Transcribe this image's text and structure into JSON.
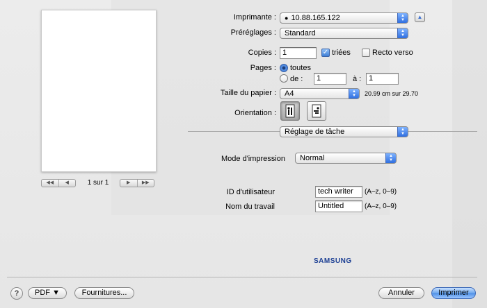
{
  "printer": {
    "label": "Imprimante :",
    "value": "10.88.165.122",
    "status_icon": "info-icon"
  },
  "presets": {
    "label": "Préréglages :",
    "value": "Standard"
  },
  "copies": {
    "label": "Copies :",
    "value": "1",
    "collated_label": "triées",
    "collated_checked": true,
    "duplex_label": "Recto verso",
    "duplex_checked": false
  },
  "pages": {
    "label": "Pages :",
    "all_label": "toutes",
    "from_label": "de :",
    "from_value": "1",
    "to_label": "à :",
    "to_value": "1",
    "selected": "all"
  },
  "paper": {
    "label": "Taille du papier :",
    "value": "A4",
    "size_text": "20.99 cm sur 29.70"
  },
  "orientation": {
    "label": "Orientation :",
    "options": [
      "portrait",
      "landscape"
    ],
    "selected": "portrait"
  },
  "section": {
    "value": "Réglage de tâche"
  },
  "print_mode": {
    "label": "Mode d'impression",
    "value": "Normal"
  },
  "user_id": {
    "label": "ID d'utilisateur",
    "value": "tech writer",
    "hint": "(A–z, 0–9)"
  },
  "job_name": {
    "label": "Nom du travail",
    "value": "Untitled",
    "hint": "(A–z, 0–9)"
  },
  "preview": {
    "page_counter": "1 sur 1"
  },
  "brand": {
    "text": "SAMSUNG",
    "color": "#1c3f94"
  },
  "footer": {
    "help": "?",
    "pdf": "PDF ▼",
    "supplies": "Fournitures...",
    "cancel": "Annuler",
    "print": "Imprimer"
  },
  "colors": {
    "accent": "#3f7fd6"
  }
}
